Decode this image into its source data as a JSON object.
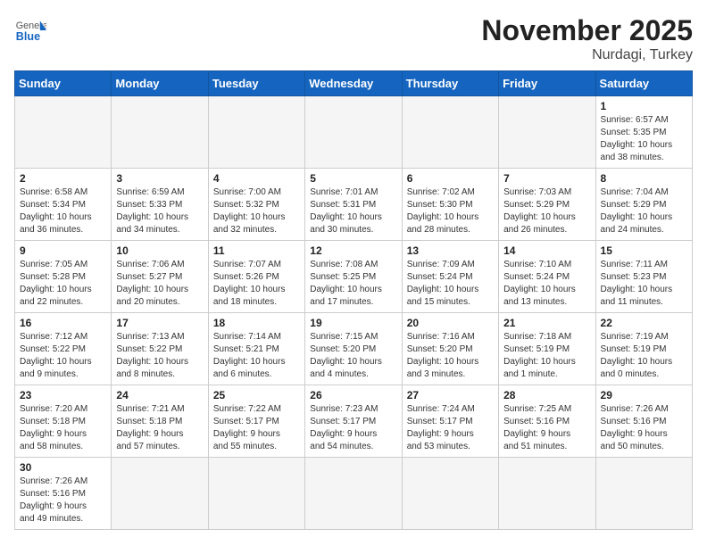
{
  "header": {
    "logo_general": "General",
    "logo_blue": "Blue",
    "month_title": "November 2025",
    "location": "Nurdagi, Turkey"
  },
  "weekdays": [
    "Sunday",
    "Monday",
    "Tuesday",
    "Wednesday",
    "Thursday",
    "Friday",
    "Saturday"
  ],
  "weeks": [
    [
      {
        "day": "",
        "info": ""
      },
      {
        "day": "",
        "info": ""
      },
      {
        "day": "",
        "info": ""
      },
      {
        "day": "",
        "info": ""
      },
      {
        "day": "",
        "info": ""
      },
      {
        "day": "",
        "info": ""
      },
      {
        "day": "1",
        "info": "Sunrise: 6:57 AM\nSunset: 5:35 PM\nDaylight: 10 hours\nand 38 minutes."
      }
    ],
    [
      {
        "day": "2",
        "info": "Sunrise: 6:58 AM\nSunset: 5:34 PM\nDaylight: 10 hours\nand 36 minutes."
      },
      {
        "day": "3",
        "info": "Sunrise: 6:59 AM\nSunset: 5:33 PM\nDaylight: 10 hours\nand 34 minutes."
      },
      {
        "day": "4",
        "info": "Sunrise: 7:00 AM\nSunset: 5:32 PM\nDaylight: 10 hours\nand 32 minutes."
      },
      {
        "day": "5",
        "info": "Sunrise: 7:01 AM\nSunset: 5:31 PM\nDaylight: 10 hours\nand 30 minutes."
      },
      {
        "day": "6",
        "info": "Sunrise: 7:02 AM\nSunset: 5:30 PM\nDaylight: 10 hours\nand 28 minutes."
      },
      {
        "day": "7",
        "info": "Sunrise: 7:03 AM\nSunset: 5:29 PM\nDaylight: 10 hours\nand 26 minutes."
      },
      {
        "day": "8",
        "info": "Sunrise: 7:04 AM\nSunset: 5:29 PM\nDaylight: 10 hours\nand 24 minutes."
      }
    ],
    [
      {
        "day": "9",
        "info": "Sunrise: 7:05 AM\nSunset: 5:28 PM\nDaylight: 10 hours\nand 22 minutes."
      },
      {
        "day": "10",
        "info": "Sunrise: 7:06 AM\nSunset: 5:27 PM\nDaylight: 10 hours\nand 20 minutes."
      },
      {
        "day": "11",
        "info": "Sunrise: 7:07 AM\nSunset: 5:26 PM\nDaylight: 10 hours\nand 18 minutes."
      },
      {
        "day": "12",
        "info": "Sunrise: 7:08 AM\nSunset: 5:25 PM\nDaylight: 10 hours\nand 17 minutes."
      },
      {
        "day": "13",
        "info": "Sunrise: 7:09 AM\nSunset: 5:24 PM\nDaylight: 10 hours\nand 15 minutes."
      },
      {
        "day": "14",
        "info": "Sunrise: 7:10 AM\nSunset: 5:24 PM\nDaylight: 10 hours\nand 13 minutes."
      },
      {
        "day": "15",
        "info": "Sunrise: 7:11 AM\nSunset: 5:23 PM\nDaylight: 10 hours\nand 11 minutes."
      }
    ],
    [
      {
        "day": "16",
        "info": "Sunrise: 7:12 AM\nSunset: 5:22 PM\nDaylight: 10 hours\nand 9 minutes."
      },
      {
        "day": "17",
        "info": "Sunrise: 7:13 AM\nSunset: 5:22 PM\nDaylight: 10 hours\nand 8 minutes."
      },
      {
        "day": "18",
        "info": "Sunrise: 7:14 AM\nSunset: 5:21 PM\nDaylight: 10 hours\nand 6 minutes."
      },
      {
        "day": "19",
        "info": "Sunrise: 7:15 AM\nSunset: 5:20 PM\nDaylight: 10 hours\nand 4 minutes."
      },
      {
        "day": "20",
        "info": "Sunrise: 7:16 AM\nSunset: 5:20 PM\nDaylight: 10 hours\nand 3 minutes."
      },
      {
        "day": "21",
        "info": "Sunrise: 7:18 AM\nSunset: 5:19 PM\nDaylight: 10 hours\nand 1 minute."
      },
      {
        "day": "22",
        "info": "Sunrise: 7:19 AM\nSunset: 5:19 PM\nDaylight: 10 hours\nand 0 minutes."
      }
    ],
    [
      {
        "day": "23",
        "info": "Sunrise: 7:20 AM\nSunset: 5:18 PM\nDaylight: 9 hours\nand 58 minutes."
      },
      {
        "day": "24",
        "info": "Sunrise: 7:21 AM\nSunset: 5:18 PM\nDaylight: 9 hours\nand 57 minutes."
      },
      {
        "day": "25",
        "info": "Sunrise: 7:22 AM\nSunset: 5:17 PM\nDaylight: 9 hours\nand 55 minutes."
      },
      {
        "day": "26",
        "info": "Sunrise: 7:23 AM\nSunset: 5:17 PM\nDaylight: 9 hours\nand 54 minutes."
      },
      {
        "day": "27",
        "info": "Sunrise: 7:24 AM\nSunset: 5:17 PM\nDaylight: 9 hours\nand 53 minutes."
      },
      {
        "day": "28",
        "info": "Sunrise: 7:25 AM\nSunset: 5:16 PM\nDaylight: 9 hours\nand 51 minutes."
      },
      {
        "day": "29",
        "info": "Sunrise: 7:26 AM\nSunset: 5:16 PM\nDaylight: 9 hours\nand 50 minutes."
      }
    ],
    [
      {
        "day": "30",
        "info": "Sunrise: 7:26 AM\nSunset: 5:16 PM\nDaylight: 9 hours\nand 49 minutes."
      },
      {
        "day": "",
        "info": ""
      },
      {
        "day": "",
        "info": ""
      },
      {
        "day": "",
        "info": ""
      },
      {
        "day": "",
        "info": ""
      },
      {
        "day": "",
        "info": ""
      },
      {
        "day": "",
        "info": ""
      }
    ]
  ]
}
